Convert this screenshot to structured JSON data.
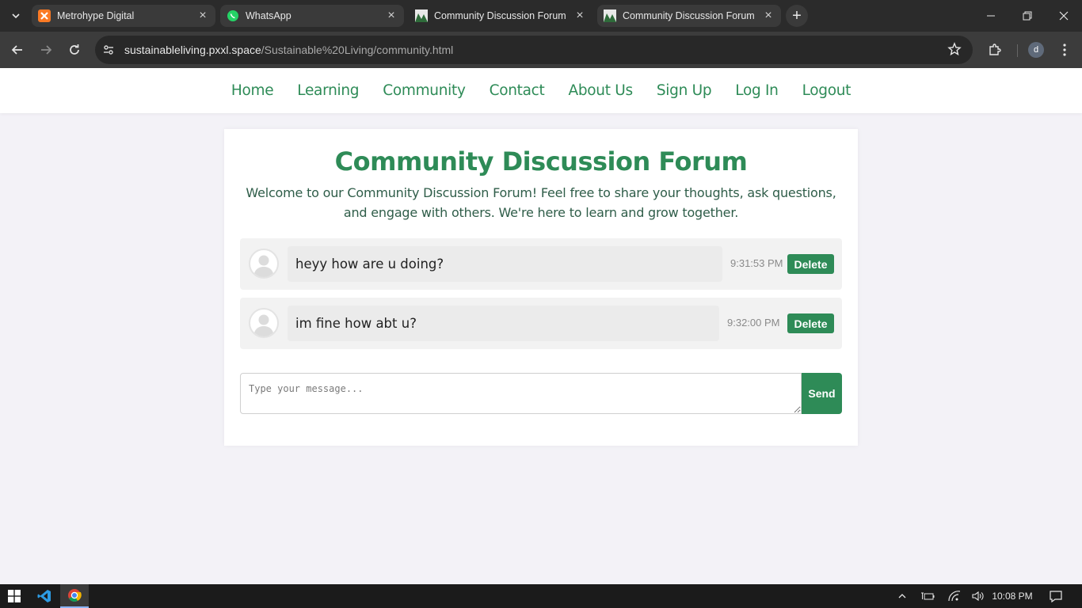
{
  "browser": {
    "tabs": [
      {
        "title": "Metrohype Digital",
        "icon": "xampp-icon",
        "active": false
      },
      {
        "title": "WhatsApp",
        "icon": "whatsapp-icon",
        "active": false
      },
      {
        "title": "Community Discussion Forum",
        "icon": "site-icon",
        "active": false
      },
      {
        "title": "Community Discussion Forum",
        "icon": "site-icon",
        "active": true
      }
    ],
    "url_domain": "sustainableliving.pxxl.space",
    "url_path": "/Sustainable%20Living/community.html",
    "profile_initial": "d"
  },
  "nav": {
    "items": [
      "Home",
      "Learning",
      "Community",
      "Contact",
      "About Us",
      "Sign Up",
      "Log In",
      "Logout"
    ]
  },
  "forum": {
    "title": "Community Discussion Forum",
    "intro": "Welcome to our Community Discussion Forum! Feel free to share your thoughts, ask questions, and engage with others. We're here to learn and grow together.",
    "messages": [
      {
        "text": "heyy how are u doing?",
        "time": "9:31:53 PM",
        "delete_label": "Delete"
      },
      {
        "text": "im fine how abt u?",
        "time": "9:32:00 PM",
        "delete_label": "Delete"
      }
    ],
    "input_placeholder": "Type your message...",
    "send_label": "Send"
  },
  "taskbar": {
    "clock": "10:08 PM"
  },
  "colors": {
    "accent": "#2e8b57",
    "page_bg": "#f3f2f7",
    "chrome_dark": "#2b2b2b"
  }
}
